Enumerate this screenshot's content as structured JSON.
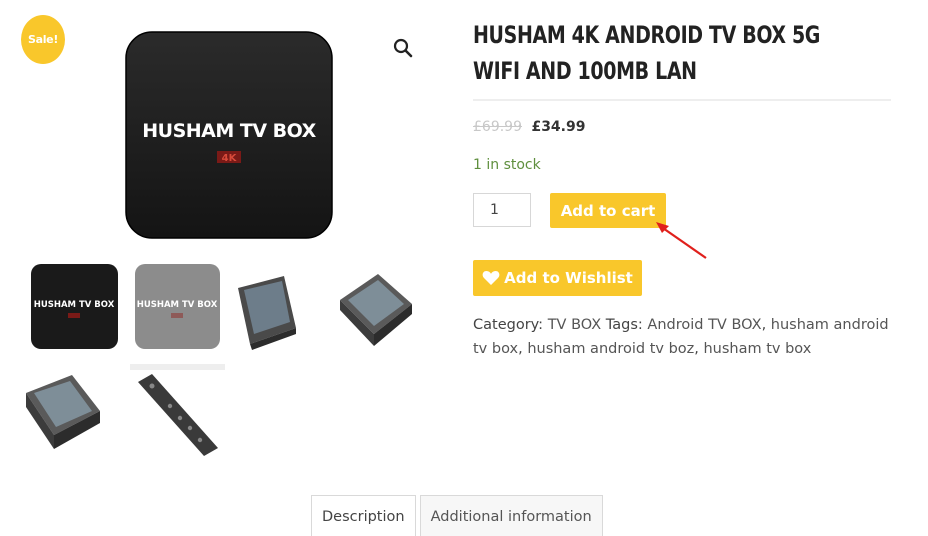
{
  "badge": {
    "sale": "Sale!"
  },
  "product": {
    "brand_box_text": "HUSHAM TV BOX",
    "brand_box_sub": "4K",
    "title": "HUSHAM 4K ANDROID TV BOX 5G WIFI AND 100MB LAN",
    "price_old": "£69.99",
    "price_new": "£34.99",
    "stock": "1 in stock",
    "quantity": "1"
  },
  "buttons": {
    "add_to_cart": "Add to cart",
    "wishlist": "Add to Wishlist"
  },
  "meta": {
    "category_label": "Category:",
    "category": "TV BOX",
    "tags_label": "Tags:",
    "tags": [
      "Android TV BOX",
      "husham android tv box",
      "husham android tv boz",
      "husham tv box"
    ]
  },
  "tabs": [
    "Description",
    "Additional information"
  ],
  "colors": {
    "accent": "#f9c72b",
    "stock": "#5f8f3e",
    "arrow": "#e0201c"
  },
  "icons": {
    "zoom": "magnifier-icon",
    "wishlist": "heart-icon"
  }
}
